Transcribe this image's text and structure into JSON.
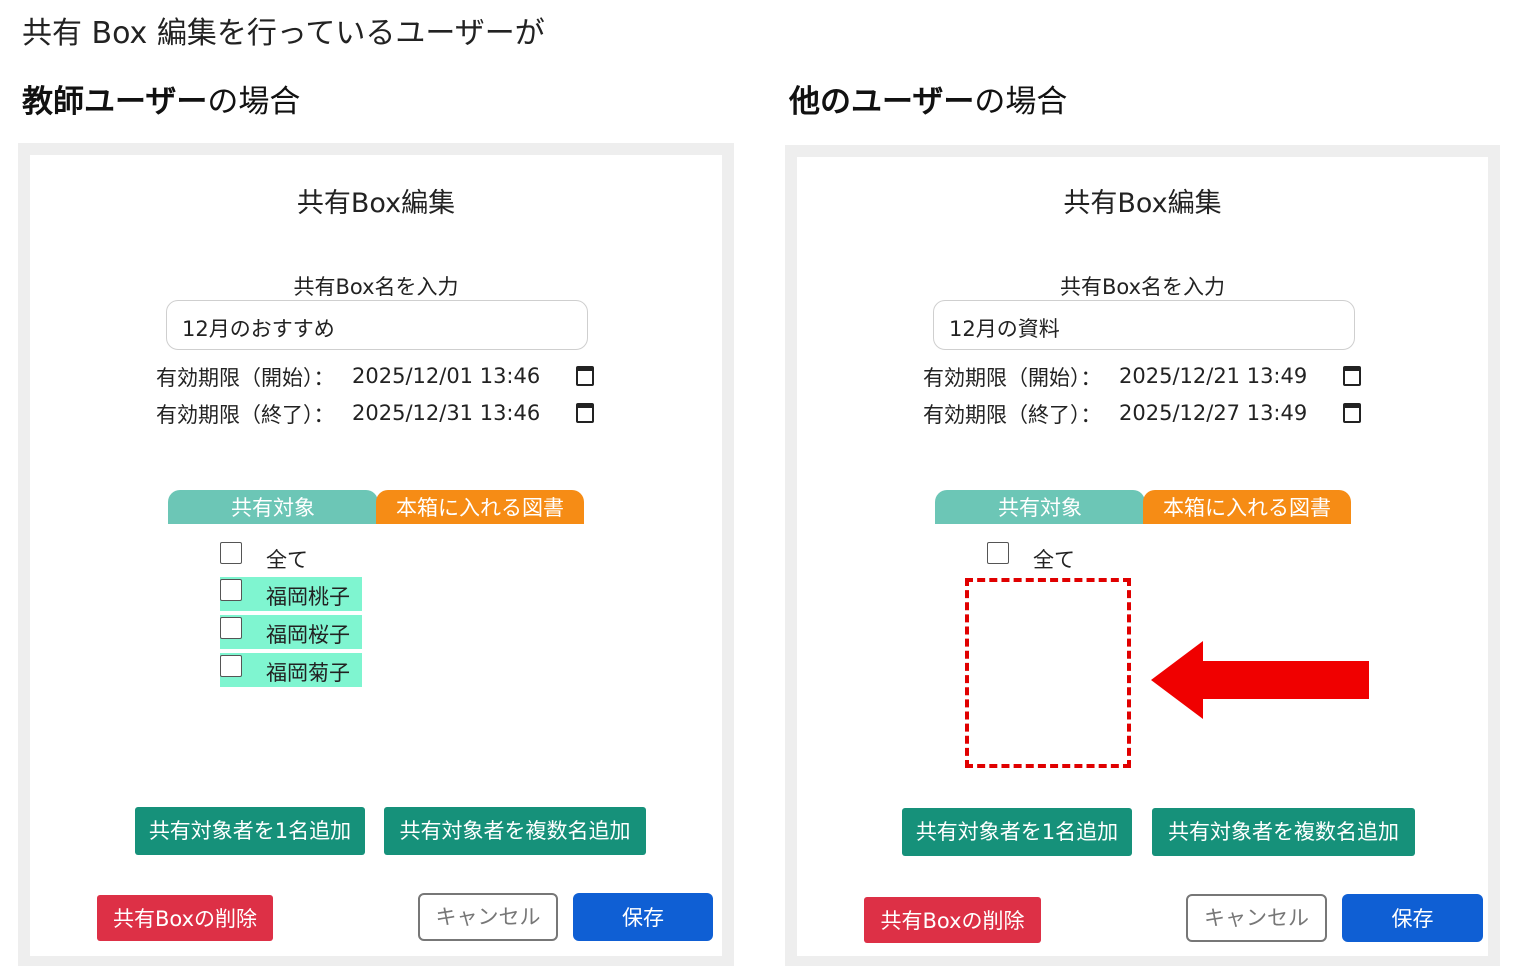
{
  "heading": "共有 Box 編集を行っているユーザーが",
  "left": {
    "caption_bold": "教師ユーザー",
    "caption_rest": "の場合",
    "dialog": {
      "title": "共有Box編集",
      "name_label": "共有Box名を入力",
      "name_value": "12月のおすすめ",
      "start_label": "有効期限（開始）：",
      "start_value": "2025/12/01 13:46",
      "end_label": "有効期限（終了）：",
      "end_value": "2025/12/31 13:46",
      "tab_share": "共有対象",
      "tab_books": "本箱に入れる図書",
      "all_label": "全て",
      "members": [
        "福岡桃子",
        "福岡桜子",
        "福岡菊子"
      ],
      "add_one": "共有対象者を1名追加",
      "add_many": "共有対象者を複数名追加",
      "delete": "共有Boxの削除",
      "cancel": "キャンセル",
      "save": "保存"
    }
  },
  "right": {
    "caption_bold": "他のユーザー",
    "caption_rest": "の場合",
    "dialog": {
      "title": "共有Box編集",
      "name_label": "共有Box名を入力",
      "name_value": "12月の資料",
      "start_label": "有効期限（開始）：",
      "start_value": "2025/12/21 13:49",
      "end_label": "有効期限（終了）：",
      "end_value": "2025/12/27 13:49",
      "tab_share": "共有対象",
      "tab_books": "本箱に入れる図書",
      "all_label": "全て",
      "add_one": "共有対象者を1名追加",
      "add_many": "共有対象者を複数名追加",
      "delete": "共有Boxの削除",
      "cancel": "キャンセル",
      "save": "保存"
    }
  },
  "colors": {
    "tab_share": "#6cc6b6",
    "tab_books": "#f68c15",
    "member_highlight": "#7ff5d0",
    "teal_button": "#16917a",
    "delete_button": "#dd3046",
    "save_button": "#0f5fd4",
    "annotation": "#e00000"
  },
  "icons": [
    "calendar-icon",
    "arrow-left-icon"
  ]
}
